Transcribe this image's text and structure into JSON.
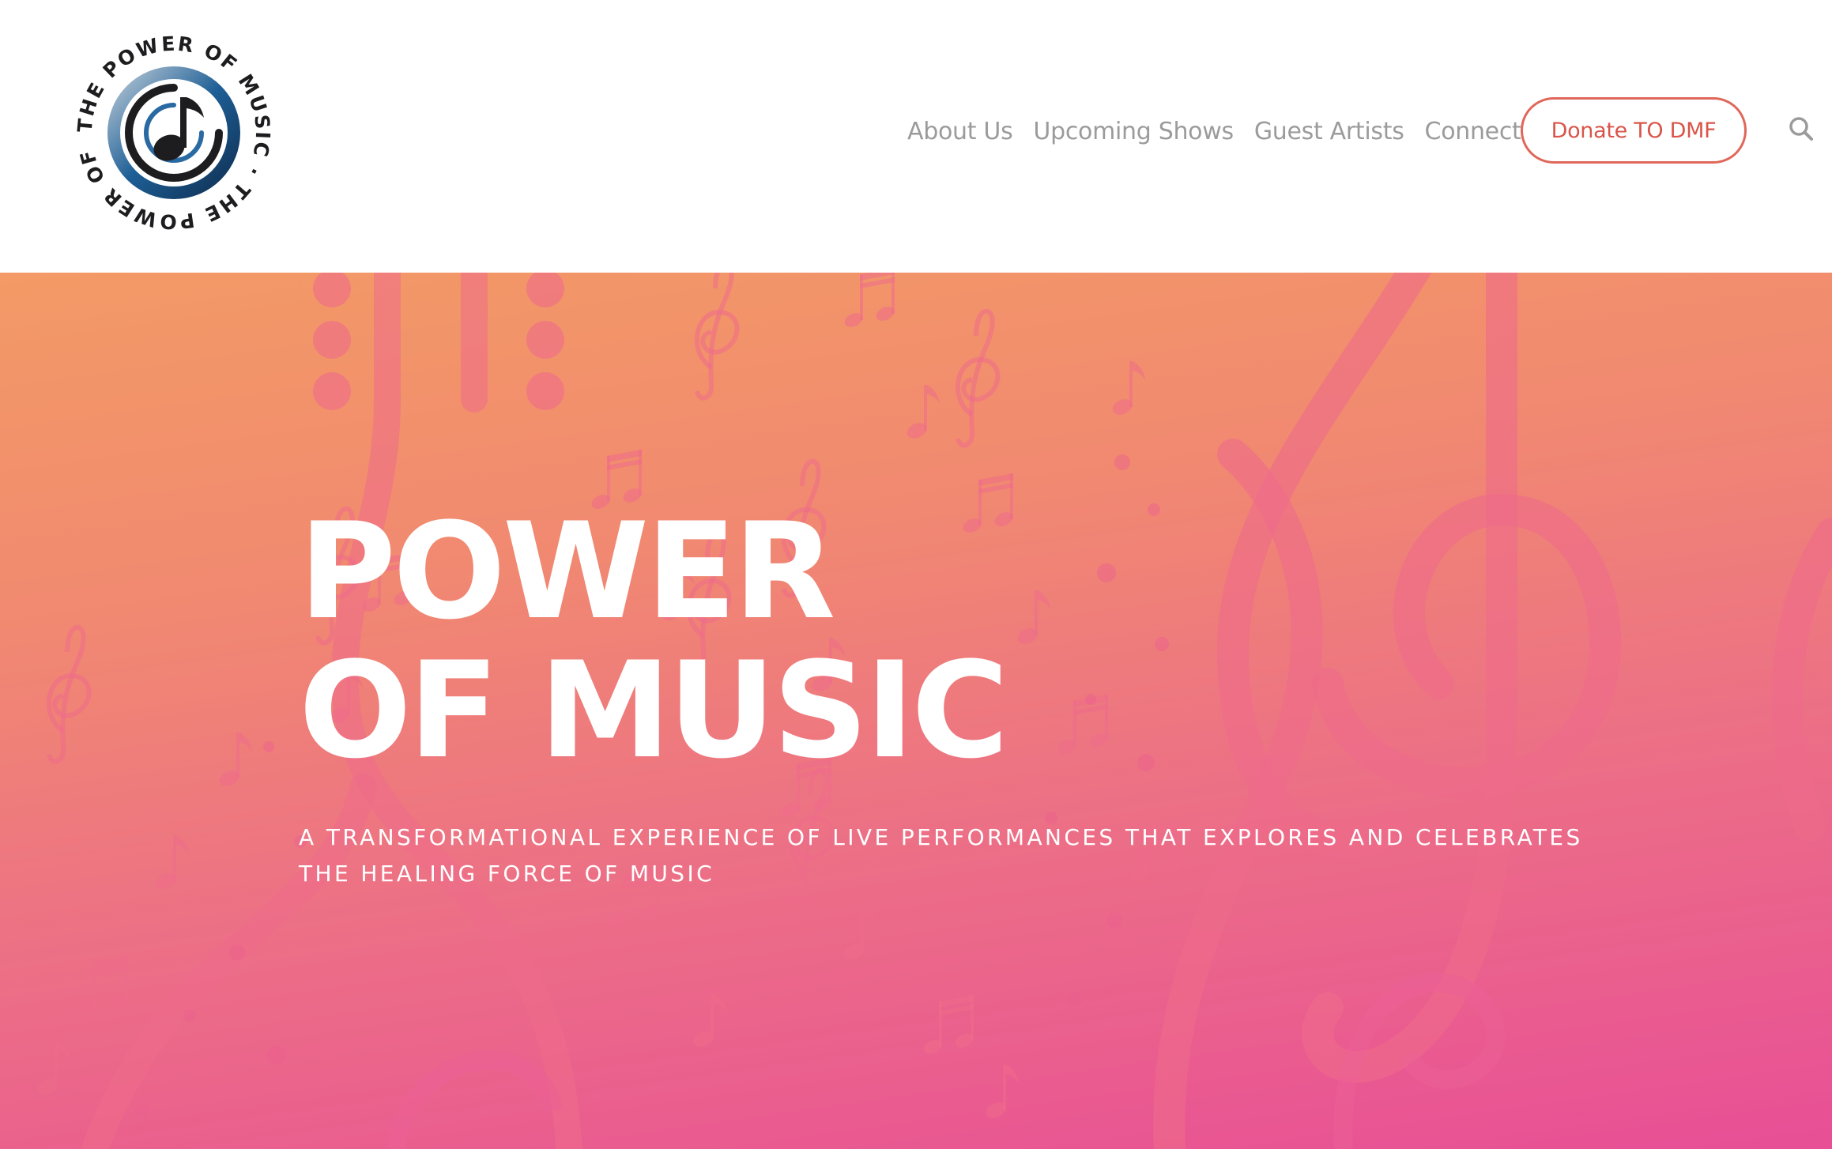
{
  "header": {
    "logo": {
      "ring_text": "THE POWER OF MUSIC · THE POWER OF MUSIC ·",
      "icon": "music-note-icon"
    },
    "nav": {
      "items": [
        {
          "label": "About Us"
        },
        {
          "label": "Upcoming Shows"
        },
        {
          "label": "Guest Artists"
        },
        {
          "label": "Connect"
        }
      ]
    },
    "donate_label": "Donate TO DMF",
    "search_icon": "search-icon"
  },
  "hero": {
    "title_line1": "POWER",
    "title_line2": "OF MUSIC",
    "subtitle": "A TRANSFORMATIONAL EXPERIENCE OF LIVE PERFORMANCES THAT EXPLORES AND CELEBRATES THE HEALING FORCE OF MUSIC",
    "background_art": "musical notes, treble clefs and guitar silhouette"
  },
  "colors": {
    "accent": "#e0675a",
    "nav_text": "#9b9b9b",
    "hero_top": "#f39a66",
    "hero_bottom": "#e84f96",
    "logo_dark": "#1d1d1f",
    "logo_blue": "#1e5f96"
  }
}
